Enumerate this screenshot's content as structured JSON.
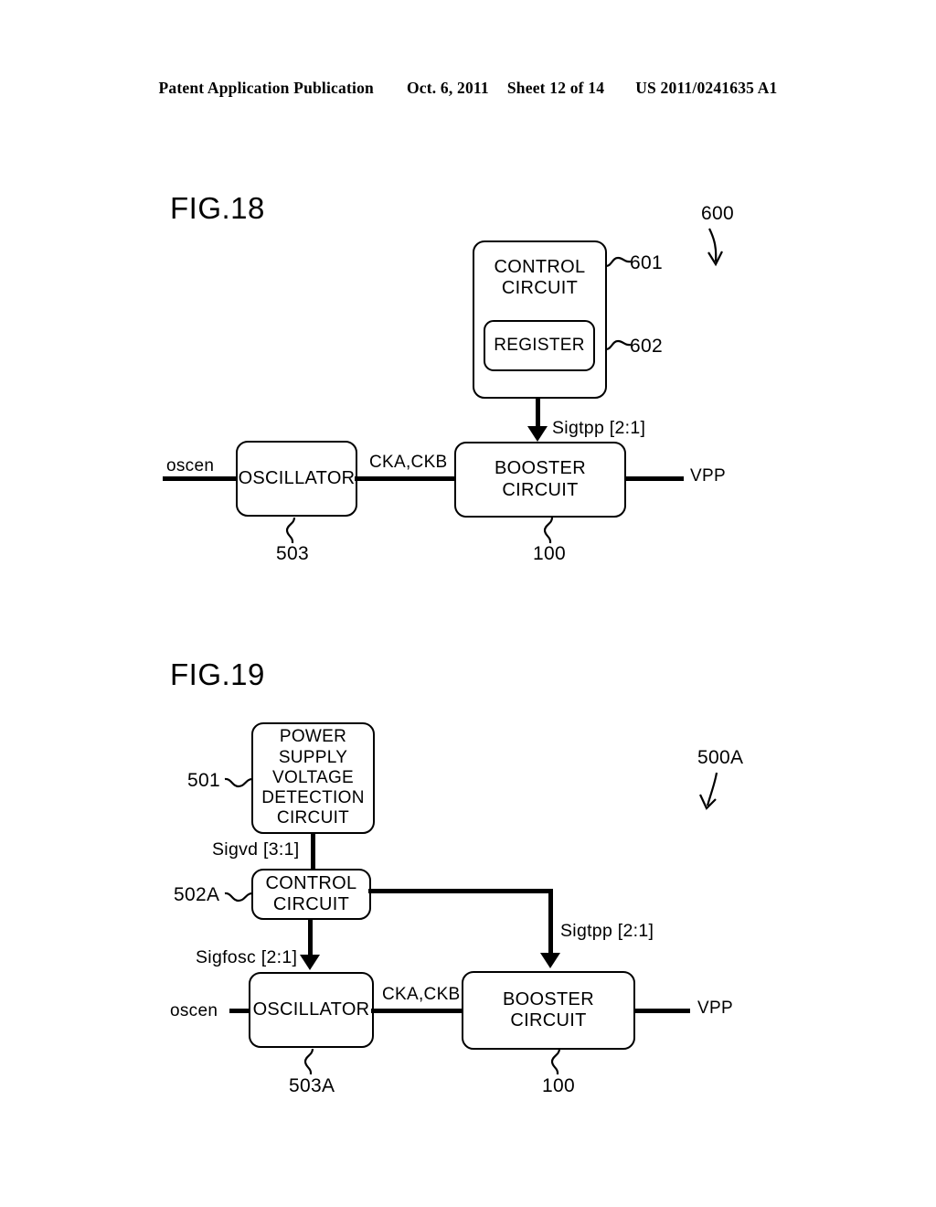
{
  "header": {
    "left": "Patent Application Publication",
    "date": "Oct. 6, 2011",
    "sheet": "Sheet 12 of 14",
    "pubnum": "US 2011/0241635 A1"
  },
  "fig18": {
    "title": "FIG.18",
    "system_ref": "600",
    "control_circuit": {
      "line1": "CONTROL",
      "line2": "CIRCUIT",
      "ref": "601"
    },
    "register": {
      "label": "REGISTER",
      "ref": "602"
    },
    "oscillator": {
      "label": "OSCILLATOR",
      "ref": "503"
    },
    "booster": {
      "line1": "BOOSTER",
      "line2": "CIRCUIT",
      "ref": "100"
    },
    "signals": {
      "oscen": "oscen",
      "cka_ckb": "CKA,CKB",
      "sigtpp": "Sigtpp [2:1]",
      "vpp": "VPP"
    }
  },
  "fig19": {
    "title": "FIG.19",
    "system_ref": "500A",
    "detection_circuit": {
      "line1": "POWER",
      "line2": "SUPPLY",
      "line3": "VOLTAGE",
      "line4": "DETECTION",
      "line5": "CIRCUIT",
      "ref": "501"
    },
    "control_circuit": {
      "line1": "CONTROL",
      "line2": "CIRCUIT",
      "ref": "502A"
    },
    "oscillator": {
      "label": "OSCILLATOR",
      "ref": "503A"
    },
    "booster": {
      "line1": "BOOSTER",
      "line2": "CIRCUIT",
      "ref": "100"
    },
    "signals": {
      "sigvd": "Sigvd [3:1]",
      "sigfosc": "Sigfosc [2:1]",
      "sigtpp": "Sigtpp [2:1]",
      "oscen": "oscen",
      "cka_ckb": "CKA,CKB",
      "vpp": "VPP"
    }
  }
}
